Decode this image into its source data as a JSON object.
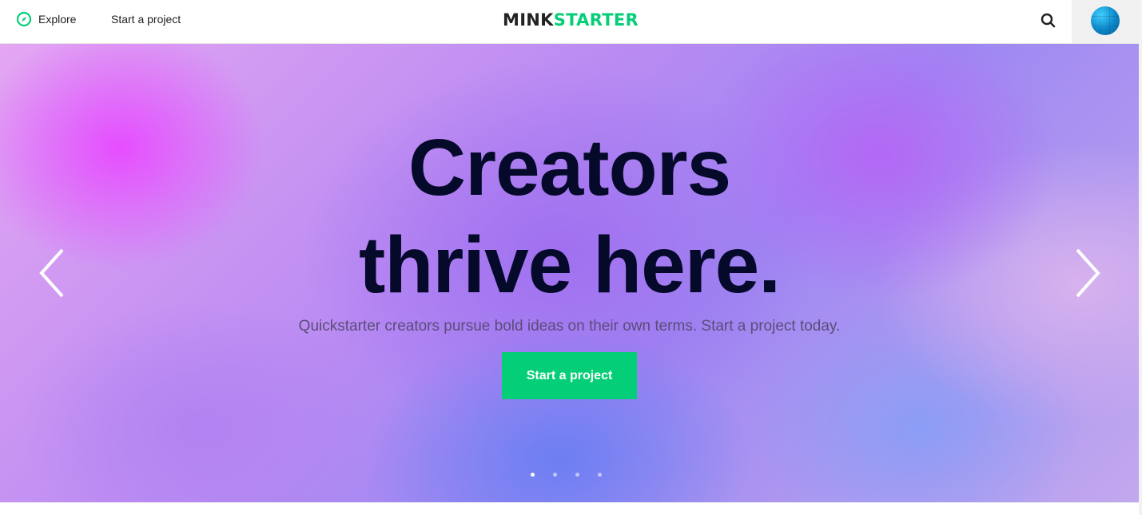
{
  "header": {
    "explore_label": "Explore",
    "start_project_label": "Start a project",
    "logo_part1": "MINK",
    "logo_part2": "STARTER"
  },
  "hero": {
    "title_line1": "Creators",
    "title_line2": "thrive here.",
    "subtitle": "Quickstarter creators pursue bold ideas on their own terms. Start a project today.",
    "cta_label": "Start a project",
    "slides_total": 4,
    "active_slide": 1
  },
  "icons": {
    "explore": "compass-icon",
    "search": "search-icon",
    "prev": "chevron-left-icon",
    "next": "chevron-right-icon",
    "avatar": "avatar"
  },
  "colors": {
    "brand_green": "#05ce78",
    "title_color": "#050a2a",
    "logo_dark": "#222222"
  }
}
